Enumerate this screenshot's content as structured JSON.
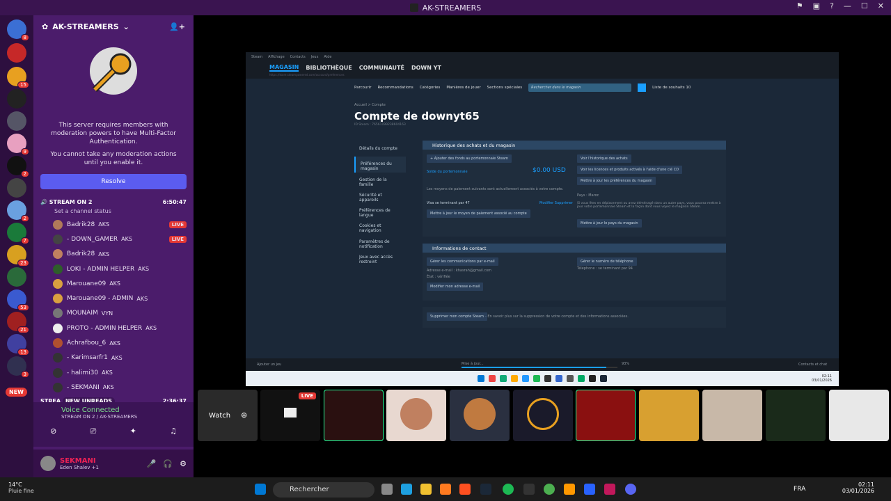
{
  "window": {
    "title": "AK-STREAMERS"
  },
  "server": {
    "name": "AK-STREAMERS",
    "notice1": "This server requires members with moderation powers to have Multi-Factor Authentication.",
    "notice2": "You cannot take any moderation actions until you enable it.",
    "resolve": "Resolve"
  },
  "voice": {
    "channel": "STREAM ON 2",
    "timer": "6:50:47",
    "status": "Set a channel status",
    "channel2": "STREA",
    "timer2": "2:36:37",
    "new_unreads": "NEW UNREADS"
  },
  "members": [
    {
      "name": "Badrik28",
      "tag": "AKS",
      "live": "LIVE",
      "color": "#b07a5a"
    },
    {
      "name": "- DOWN_GAMER",
      "tag": "AKS",
      "live": "LIVE",
      "color": "#444"
    },
    {
      "name": "Badrik28",
      "tag": "AKS",
      "live": "",
      "color": "#c08060"
    },
    {
      "name": "LOKI - ADMIN HELPER",
      "tag": "AKS",
      "live": "",
      "color": "#2e5e2a"
    },
    {
      "name": "Marouane09",
      "tag": "AKS",
      "live": "",
      "color": "#d9a040"
    },
    {
      "name": "Marouane09 - ADMIN",
      "tag": "AKS",
      "live": "",
      "color": "#d9a040"
    },
    {
      "name": "MOUNAIM",
      "tag": "VYN",
      "live": "",
      "color": "#777"
    },
    {
      "name": "PROTO - ADMIN HELPER",
      "tag": "AKS",
      "live": "",
      "color": "#eee"
    },
    {
      "name": "Achrafbou_6",
      "tag": "AKS",
      "live": "",
      "color": "#b05030"
    },
    {
      "name": "- Karimsarfr1",
      "tag": "AKS",
      "live": "",
      "color": "#333"
    },
    {
      "name": "- halimi30",
      "tag": "AKS",
      "live": "",
      "color": "#333"
    },
    {
      "name": "- SEKMANI",
      "tag": "AKS",
      "live": "",
      "color": "#333"
    }
  ],
  "voice_connected": {
    "title": "Voice Connected",
    "sub": "STREAM ON 2 / AK-STREAMERS"
  },
  "user": {
    "name": "SEKMANI",
    "activity": "Eden Shalev +1"
  },
  "guild_badges": [
    "8",
    "15",
    "9",
    "2",
    "2",
    "7",
    "23",
    "53",
    "21",
    "13",
    "3"
  ],
  "new_label": "NEW",
  "steam": {
    "topmenu": [
      "Steam",
      "Affichage",
      "Contacts",
      "Jeux",
      "Aide"
    ],
    "nav": [
      "MAGASIN",
      "BIBLIOTHÈQUE",
      "COMMUNAUTÉ",
      "DOWN YT"
    ],
    "url": "https://store.steampowered.com/account/preferences",
    "menu": [
      "Parcourir",
      "Recommandations",
      "Catégories",
      "Manières de jouer",
      "Sections spéciales"
    ],
    "search_placeholder": "Rechercher dans le magasin",
    "wishlist": "Liste de souhaits",
    "wishlist_count": "10",
    "crumb": "Accueil > Compte",
    "title": "Compte de downyt65",
    "steam_id": "ID Steam : 76561199238604163",
    "sidebar": [
      "Détails du compte",
      "Préférences du magasin",
      "Gestion de la famille",
      "Sécurité et appareils",
      "Préférences de langue",
      "Cookies et navigation",
      "Paramètres de notification",
      "Jeux avec accès restreint"
    ],
    "history_title": "Historique des achats et du magasin",
    "add_funds": "+ Ajouter des fonds au portemonnaie Steam",
    "wallet_label": "Solde du portemonnaie",
    "wallet_value": "$0.00 USD",
    "payment_note": "Les moyens de paiement suivants sont actuellement associés à votre compte.",
    "visa": "Visa se terminant par 47",
    "modify": "Modifier Supprimer",
    "update_payment": "Mettre à jour le moyen de paiement associé au compte",
    "view_history": "Voir l'historique des achats",
    "view_licenses": "Voir les licences et produits activés à l'aide d'une clé CD",
    "update_prefs": "Mettre à jour les préférences du magasin",
    "country": "Pays : Maroc",
    "country_note": "Si vous êtes en déplacement ou avez déménagé dans un autre pays, vous pouvez mettre à jour votre portemonnaie Steam et la façon dont vous voyez le magasin Steam.",
    "update_country": "Mettre à jour le pays du magasin",
    "contact_title": "Informations de contact",
    "manage_email": "Gérer les communications par e-mail",
    "email_label": "Adresse e-mail : khasrah@gmail.com",
    "email_state": "État : vérifiée",
    "edit_email": "Modifier mon adresse e-mail",
    "manage_phone": "Gérer le numéro de téléphone",
    "phone": "Téléphone : se terminant par 94",
    "delete_account": "Supprimer mon compte Steam",
    "delete_note": "- En savoir plus sur la suppression de votre compte et des informations associées.",
    "add_game": "Ajouter un jeu",
    "download": "Mise à jour...",
    "download_pct": "93%",
    "friends": "Contacts et chat",
    "inner_clock": "02:11",
    "inner_date": "03/01/2026"
  },
  "stream_strip": {
    "watch": "Watch",
    "live": "LIVE"
  },
  "taskbar": {
    "temp": "14°C",
    "weather": "Pluie fine",
    "search": "Rechercher",
    "lang": "FRA",
    "time": "02:11",
    "date": "03/01/2026"
  }
}
